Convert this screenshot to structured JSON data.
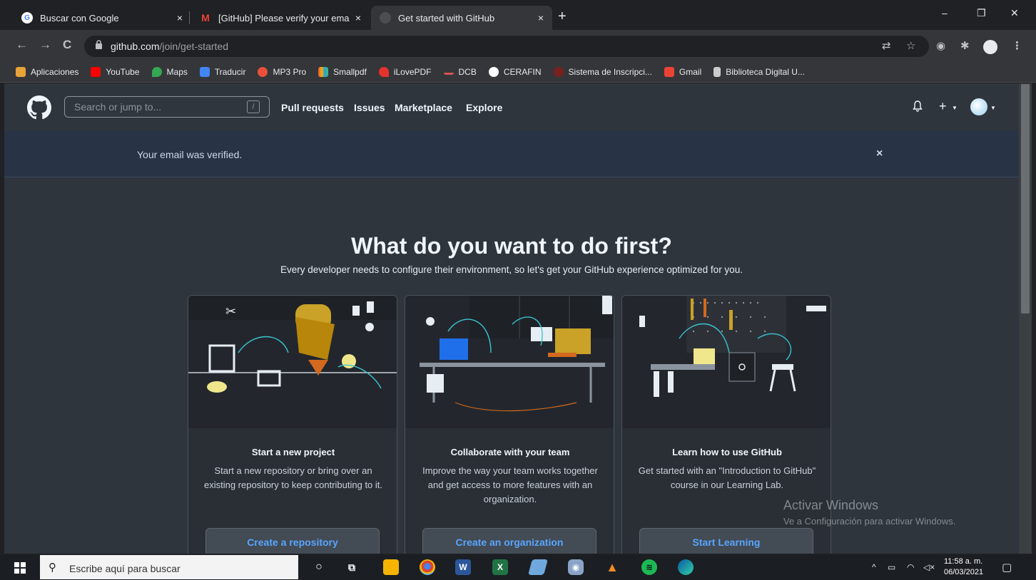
{
  "browser": {
    "tabs": [
      {
        "title": "Buscar con Google",
        "close": "×"
      },
      {
        "title": "[GitHub] Please verify your email",
        "close": "×"
      },
      {
        "title": "Get started with GitHub",
        "close": "×"
      }
    ],
    "new_tab": "+",
    "window_controls": {
      "minimize": "–",
      "maximize": "❐",
      "close": "✕"
    },
    "address": {
      "host": "github.com",
      "path": "/join/get-started"
    },
    "bookmarks": [
      {
        "label": "Aplicaciones",
        "color": "#e8a33a"
      },
      {
        "label": "YouTube",
        "color": "#ff0000"
      },
      {
        "label": "Maps",
        "color": "#34a853"
      },
      {
        "label": "Traducir",
        "color": "#4285f4"
      },
      {
        "label": "MP3 Pro",
        "color": "#e8503a"
      },
      {
        "label": "Smallpdf",
        "color": "#f4b400"
      },
      {
        "label": "iLovePDF",
        "color": "#e5322d"
      },
      {
        "label": "DCB",
        "color": "#d9534f"
      },
      {
        "label": "CERAFIN",
        "color": "#ffffff"
      },
      {
        "label": "Sistema de Inscripci...",
        "color": "#7a1f1f"
      },
      {
        "label": "Gmail",
        "color": "#ea4335"
      },
      {
        "label": "Biblioteca Digital U...",
        "color": "#cccccc"
      }
    ]
  },
  "github": {
    "search_placeholder": "Search or jump to...",
    "search_shortcut": "/",
    "nav": [
      "Pull requests",
      "Issues",
      "Marketplace",
      "Explore"
    ],
    "flash": {
      "message": "Your email was verified.",
      "close": "×"
    },
    "heading": "What do you want to do first?",
    "subheading": "Every developer needs to configure their environment, so let's get your GitHub experience optimized for you.",
    "cards": [
      {
        "title": "Start a new project",
        "description": "Start a new repository or bring over an existing repository to keep contributing to it.",
        "button": "Create a repository"
      },
      {
        "title": "Collaborate with your team",
        "description": "Improve the way your team works together and get access to more features with an organization.",
        "button": "Create an organization"
      },
      {
        "title": "Learn how to use GitHub",
        "description": "Get started with an \"Introduction to GitHub\" course in our Learning Lab.",
        "button": "Start Learning"
      }
    ],
    "accent": "#58a6ff"
  },
  "watermark": {
    "line1": "Activar Windows",
    "line2": "Ve a Configuración para activar Windows."
  },
  "taskbar": {
    "search_placeholder": "Escribe aquí para buscar",
    "time": "11:58 a. m.",
    "date": "06/03/2021"
  }
}
